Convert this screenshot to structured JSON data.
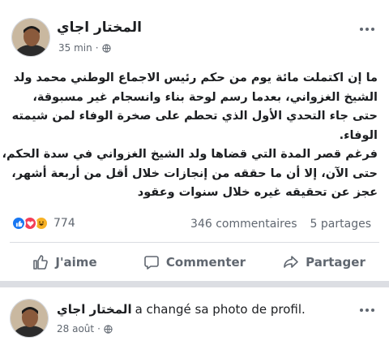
{
  "post": {
    "author": "المختار اجاي",
    "time": "35 min",
    "separator": "·",
    "body": [
      "ما إن اكتملت مائة يوم من حكم رئيس الاجماع الوطني محمد ولد",
      "الشيخ الغزواني، بعدما رسم لوحة بناء وانسجام غير مسبوقة،",
      "حتى جاء التحدي الأول الذي تحطم على صخرة الوفاء لمن شيمته",
      "الوفاء.",
      "فرغم قصر المدة التي قضاها ولد الشيخ الغزواني في سدة الحكم،",
      "حتى الآن، إلا أن ما حققه من إنجازات خلال أقل من أربعة أشهر،",
      "عجز عن تحقيقه غيره خلال سنوات وعقود"
    ],
    "reaction_count": "774",
    "comments": "346 commentaires",
    "shares": "5 partages",
    "actions": {
      "like": "J'aime",
      "comment": "Commenter",
      "share": "Partager"
    }
  },
  "post2": {
    "author": "المختار اجاي",
    "action": "a changé sa photo de profil.",
    "time": "28 août",
    "separator": "·"
  },
  "colors": {
    "like": "#1877f2",
    "love": "#f33e58",
    "haha": "#f7b125",
    "secondary_text": "#606770"
  },
  "icons": [
    "globe-icon",
    "more-options-icon",
    "like-reaction-icon",
    "love-reaction-icon",
    "haha-reaction-icon",
    "thumbs-up-icon",
    "comment-icon",
    "share-icon"
  ]
}
